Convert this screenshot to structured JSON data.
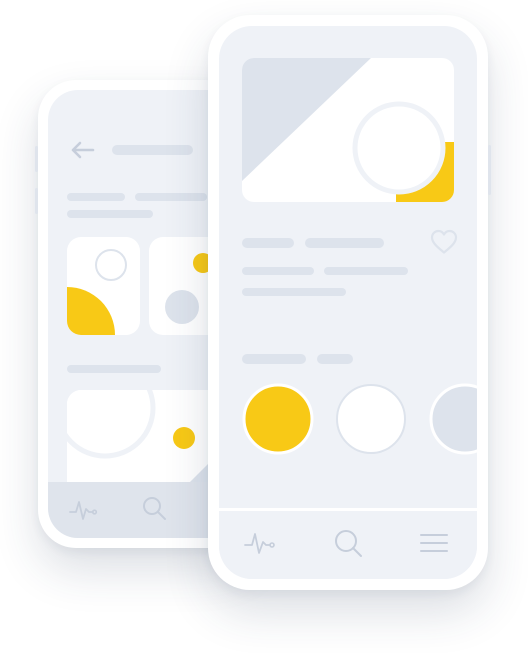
{
  "colors": {
    "accent": "#f8c916",
    "placeholder": "#dde3ec",
    "screen": "#eff2f7",
    "frame": "#ffffff",
    "tabbar": "#dfe4ec",
    "icon": "#c6cedb"
  },
  "back_phone": {
    "header_icon": "arrow-left-icon",
    "tab_icons": [
      "activity-pulse-icon",
      "search-icon"
    ]
  },
  "front_phone": {
    "favorite_icon": "heart-outline-icon",
    "tab_icons": [
      "activity-pulse-icon",
      "search-icon",
      "menu-icon"
    ]
  }
}
